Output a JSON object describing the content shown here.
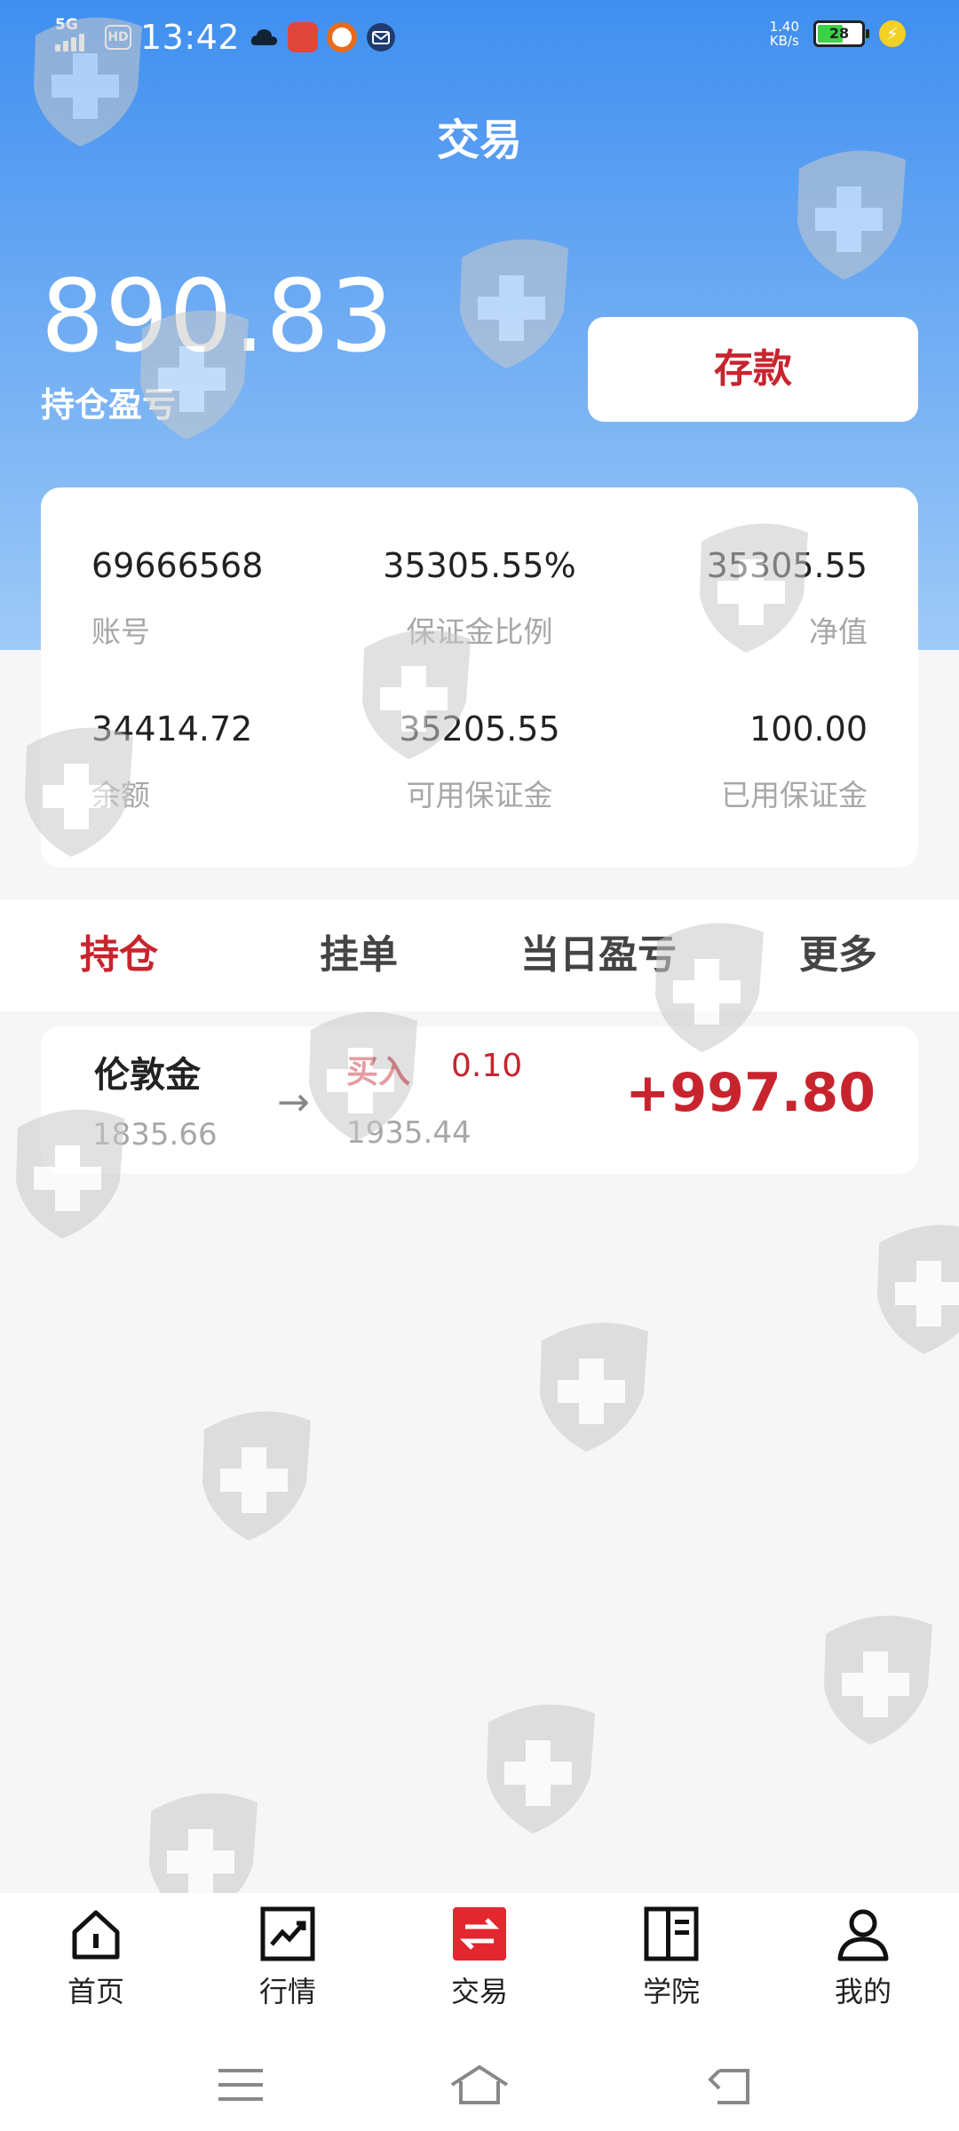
{
  "status_bar": {
    "network": "5G",
    "hd": "HD",
    "time": "13:42",
    "speed_value": "1.40",
    "speed_unit": "KB/s",
    "battery": "28"
  },
  "header": {
    "title": "交易"
  },
  "summary": {
    "pnl_value": "890.83",
    "pnl_label": "持仓盈亏",
    "deposit_label": "存款"
  },
  "account": {
    "stats": [
      {
        "value": "69666568",
        "label": "账号"
      },
      {
        "value": "35305.55%",
        "label": "保证金比例"
      },
      {
        "value": "35305.55",
        "label": "净值"
      },
      {
        "value": "34414.72",
        "label": "余额"
      },
      {
        "value": "35205.55",
        "label": "可用保证金"
      },
      {
        "value": "100.00",
        "label": "已用保证金"
      }
    ]
  },
  "tabs": [
    {
      "label": "持仓",
      "active": true
    },
    {
      "label": "挂单",
      "active": false
    },
    {
      "label": "当日盈亏",
      "active": false
    },
    {
      "label": "更多",
      "active": false
    }
  ],
  "positions": [
    {
      "symbol": "伦敦金",
      "open_price": "1835.66",
      "side": "买入",
      "lots": "0.10",
      "current_price": "1935.44",
      "profit": "+997.80"
    }
  ],
  "bottom_nav": [
    {
      "label": "首页",
      "icon": "home-icon"
    },
    {
      "label": "行情",
      "icon": "chart-icon"
    },
    {
      "label": "交易",
      "icon": "exchange-icon",
      "active": true
    },
    {
      "label": "学院",
      "icon": "book-icon"
    },
    {
      "label": "我的",
      "icon": "user-icon"
    }
  ],
  "colors": {
    "accent": "#c8242e",
    "header_blue": "#3f8ff0"
  }
}
